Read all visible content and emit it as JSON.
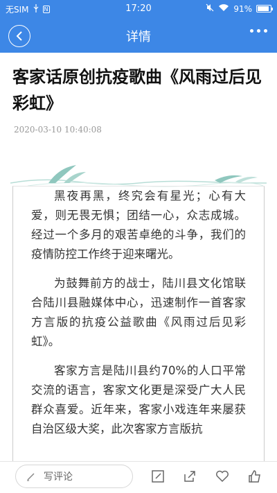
{
  "status_bar": {
    "carrier": "无SIM",
    "time": "17:20",
    "battery_percent": "91%",
    "battery_level": 0.91
  },
  "nav": {
    "title": "详情"
  },
  "article": {
    "title": "客家话原创抗疫歌曲《风雨过后见彩虹》",
    "datetime": "2020-03-10  10:40:08",
    "paragraphs": [
      "黑夜再黑，终究会有星光；心有大爱，则无畏无惧；团结一心，众志成城。经过一个多月的艰苦卓绝的斗争，我们的疫情防控工作终于迎来曙光。",
      "为鼓舞前方的战士，陆川县文化馆联合陆川县融媒体中心，迅速制作一首客家方言版的抗疫公益歌曲《风雨过后见彩虹》。",
      "客家方言是陆川县约70%的人口平常交流的语言，客家文化更是深受广大人民群众喜爱。近年来，客家小戏连年来屡获自治区级大奖，此次客家方言版抗"
    ]
  },
  "bottom_bar": {
    "comment_placeholder": "写评论"
  },
  "colors": {
    "primary": "#3d87e6",
    "ornament": "#8fc7be"
  }
}
